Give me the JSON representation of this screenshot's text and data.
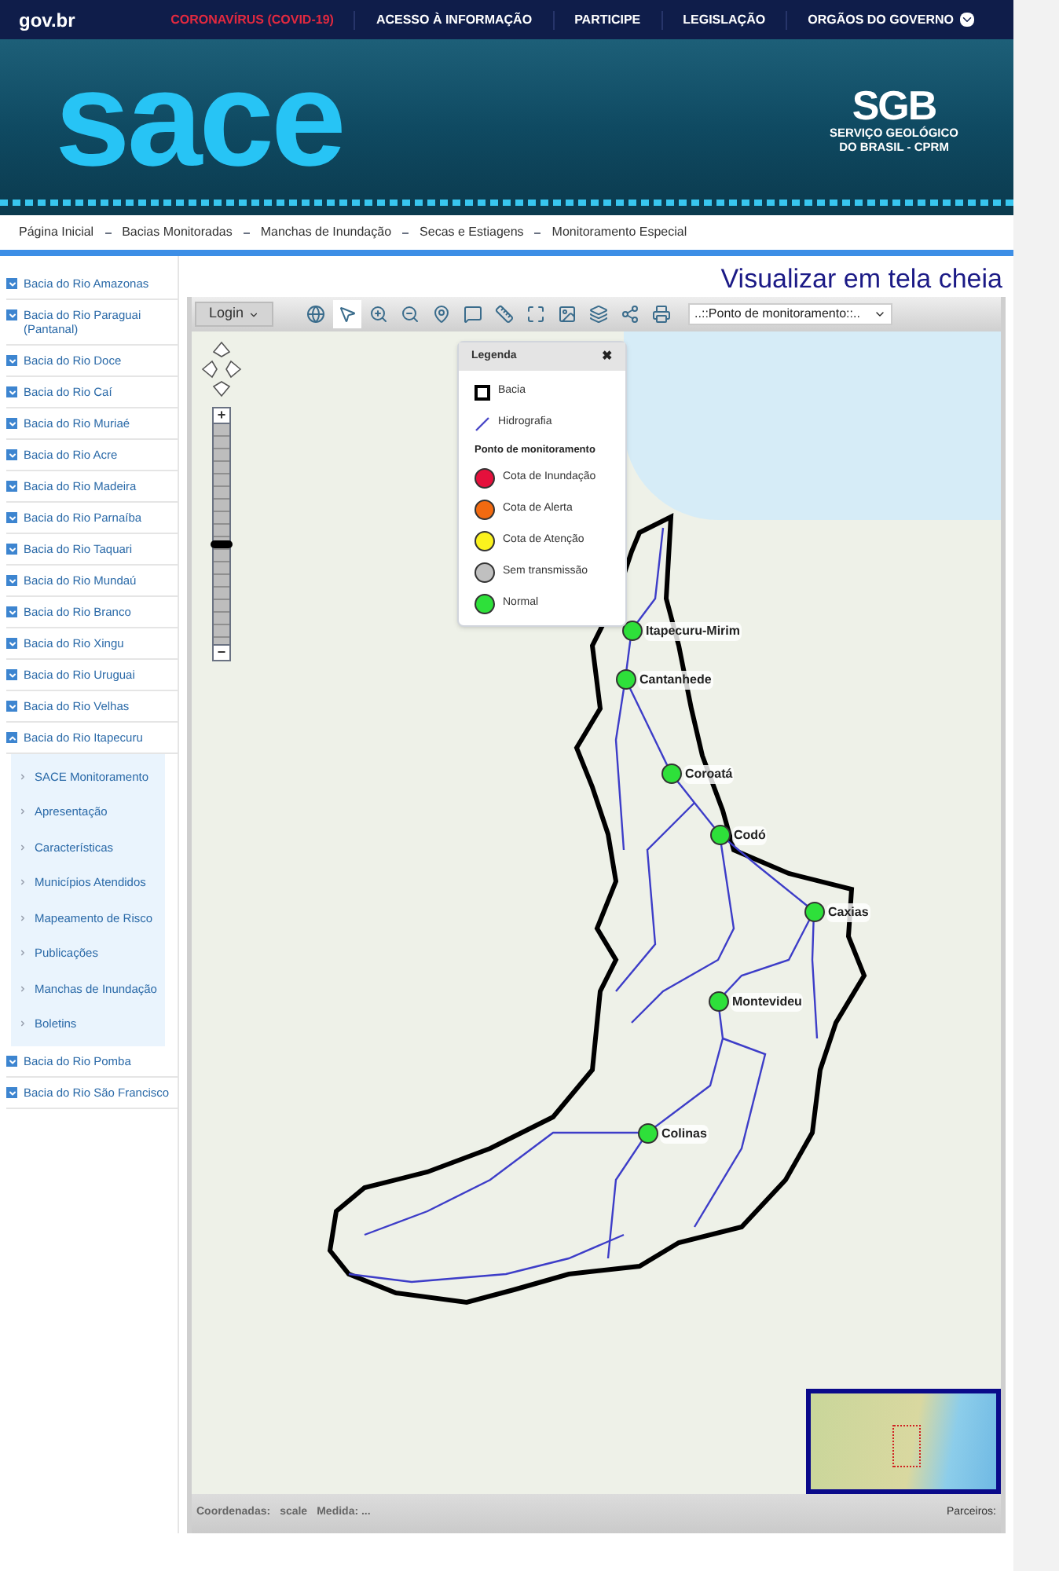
{
  "top_bar": {
    "logo": "gov.br",
    "links": [
      {
        "label": "CORONAVÍRUS (COVID-19)",
        "kind": "alert"
      },
      {
        "label": "ACESSO À INFORMAÇÃO",
        "kind": "plain"
      },
      {
        "label": "PARTICIPE",
        "kind": "plain"
      },
      {
        "label": "LEGISLAÇÃO",
        "kind": "plain"
      },
      {
        "label": "ORGÃOS DO GOVERNO",
        "kind": "dropdown"
      }
    ]
  },
  "banner": {
    "logo": "sace",
    "partner_logo": "SGB",
    "partner_name": "SERVIÇO GEOLÓGICO",
    "partner_name_2": "DO BRASIL - CPRM"
  },
  "breadcrumb": [
    "Página Inicial",
    "Bacias Monitoradas",
    "Manchas de Inundação",
    "Secas e Estiagens",
    "Monitoramento Especial"
  ],
  "sidebar": {
    "items": [
      {
        "label": "Bacia do Rio Amazonas",
        "expanded": false
      },
      {
        "label": "Bacia do Rio Paraguai (Pantanal)",
        "expanded": false
      },
      {
        "label": "Bacia do Rio Doce",
        "expanded": false
      },
      {
        "label": "Bacia do Rio Caí",
        "expanded": false
      },
      {
        "label": "Bacia do Rio Muriaé",
        "expanded": false
      },
      {
        "label": "Bacia do Rio Acre",
        "expanded": false
      },
      {
        "label": "Bacia do Rio Madeira",
        "expanded": false
      },
      {
        "label": "Bacia do Rio Parnaíba",
        "expanded": false
      },
      {
        "label": "Bacia do Rio Taquari",
        "expanded": false
      },
      {
        "label": "Bacia do Rio Mundaú",
        "expanded": false
      },
      {
        "label": "Bacia do Rio Branco",
        "expanded": false
      },
      {
        "label": "Bacia do Rio Xingu",
        "expanded": false
      },
      {
        "label": "Bacia do Rio Uruguai",
        "expanded": false
      },
      {
        "label": "Bacia do Rio Velhas",
        "expanded": false
      },
      {
        "label": "Bacia do Rio Itapecuru",
        "expanded": true,
        "children": [
          {
            "label": "SACE Monitoramento"
          },
          {
            "label": "Apresentação"
          },
          {
            "label": "Características"
          },
          {
            "label": "Municípios Atendidos"
          },
          {
            "label": "Mapeamento de Risco"
          },
          {
            "label": "Publicações"
          },
          {
            "label": "Manchas de Inundação"
          },
          {
            "label": "Boletins"
          }
        ]
      },
      {
        "label": "Bacia do Rio Pomba",
        "expanded": false
      },
      {
        "label": "Bacia do Rio São Francisco",
        "expanded": false
      }
    ]
  },
  "fullscreen_link": "Visualizar em tela cheia",
  "toolbar": {
    "login": "Login",
    "station_select": "..::Ponto de monitoramento::.."
  },
  "map": {
    "zoom_in": "+",
    "zoom_out": "−",
    "zoom": {
      "level": 0.45
    },
    "legend": {
      "title": "Legenda",
      "close": "✖",
      "items": [
        {
          "kind": "area",
          "label": "Bacia"
        },
        {
          "kind": "line",
          "label": "Hidrografia"
        },
        {
          "kind": "heading",
          "label": "Ponto de monitoramento"
        },
        {
          "kind": "dot",
          "label": "Cota de Inundação",
          "color": "#e5103c"
        },
        {
          "kind": "dot",
          "label": "Cota de Alerta",
          "color": "#f26a10"
        },
        {
          "kind": "dot",
          "label": "Cota de Atenção",
          "color": "#fbf21e"
        },
        {
          "kind": "dot",
          "label": "Sem transmissão",
          "color": "#c0c0c0"
        },
        {
          "kind": "dot",
          "label": "Normal",
          "color": "#2ee03a"
        }
      ]
    },
    "stations": [
      {
        "label": "Itapecuru-Mirim",
        "color": "#2ee03a"
      },
      {
        "label": "Cantanhede",
        "color": "#2ee03a"
      },
      {
        "label": "Coroatá",
        "color": "#2ee03a"
      },
      {
        "label": "Codó",
        "color": "#2ee03a"
      },
      {
        "label": "Caxias",
        "color": "#2ee03a"
      },
      {
        "label": "Montevideu",
        "color": "#2ee03a"
      },
      {
        "label": "Colinas",
        "color": "#2ee03a"
      }
    ]
  },
  "footer": {
    "coordinates": "Coordenadas:",
    "scale": "scale",
    "measure": "Medida: ...",
    "partners": "Parceiros:"
  }
}
